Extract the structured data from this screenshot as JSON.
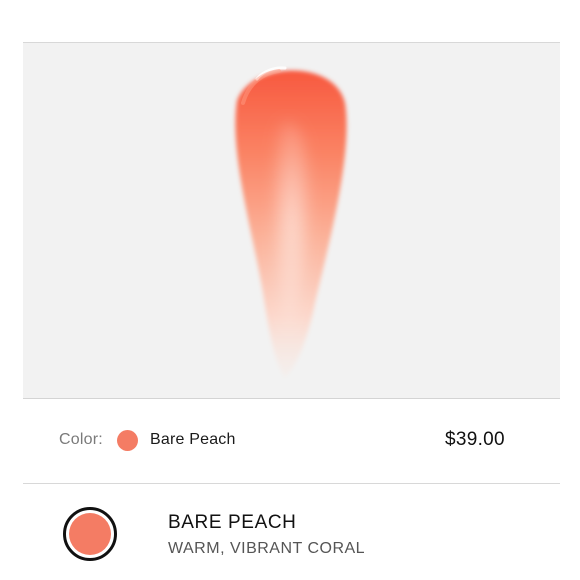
{
  "product": {
    "swatch_image_icon": "lip-gloss-swatch",
    "color_label": "Color:",
    "color_name": "Bare Peach",
    "color_hex": "#f47c64",
    "price": "$39.00"
  },
  "shades": [
    {
      "name": "BARE PEACH",
      "description": "WARM, VIBRANT CORAL",
      "hex": "#f47c64",
      "selected": true
    }
  ]
}
